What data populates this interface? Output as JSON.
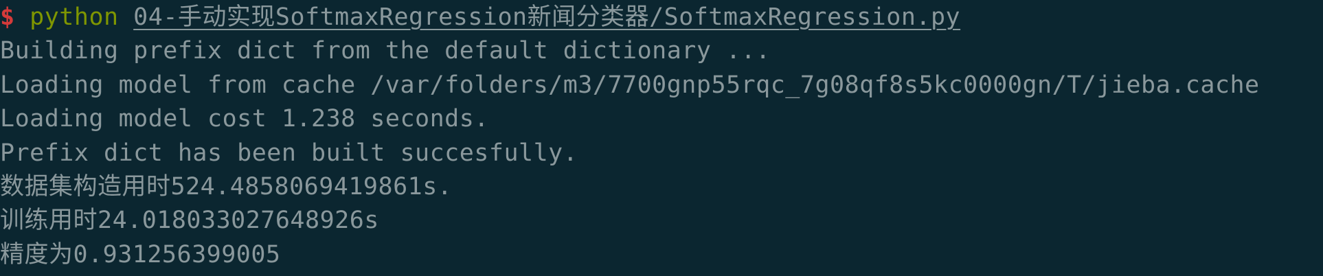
{
  "terminal": {
    "prompt": "$",
    "command": "python",
    "script_path": "04-手动实现SoftmaxRegression新闻分类器/SoftmaxRegression.py",
    "output_lines": [
      "Building prefix dict from the default dictionary ...",
      "Loading model from cache /var/folders/m3/7700gnp55rqc_7g08qf8s5kc0000gn/T/jieba.cache",
      "Loading model cost 1.238 seconds.",
      "Prefix dict has been built succesfully.",
      "数据集构造用时524.4858069419861s.",
      "训练用时24.018033027648926s",
      "精度为0.931256399005"
    ]
  },
  "colors": {
    "background": "#0b2630",
    "prompt": "#d43a3a",
    "command": "#7f9600",
    "text": "#8a989c"
  }
}
